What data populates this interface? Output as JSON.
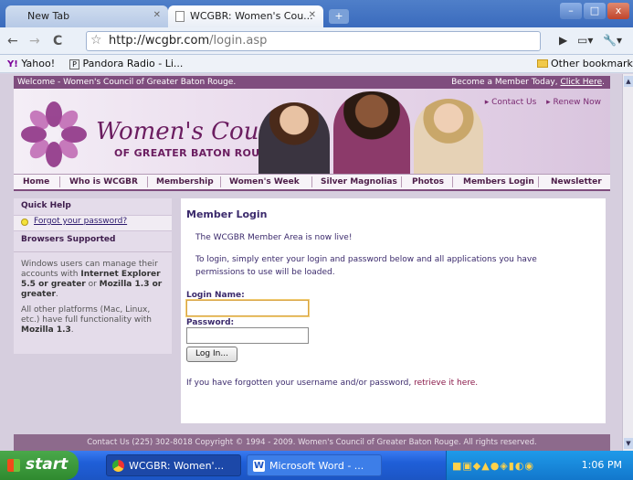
{
  "browser": {
    "tabs": [
      {
        "label": "New Tab"
      },
      {
        "label": "WCGBR: Women's Cou..."
      }
    ],
    "url_host": "http://wcgbr.com",
    "url_path": "/login.asp",
    "bookmarks": [
      "Yahoo!",
      "Pandora Radio - Li...",
      "Other bookmarks"
    ],
    "window_buttons": [
      "–",
      "□",
      "x"
    ]
  },
  "site": {
    "welcome": "Welcome - Women's Council of Greater Baton Rouge.",
    "become_member": "Become a Member Today,",
    "click_here": "Click Here",
    "toplinks": [
      "▸ Contact Us",
      "▸ Renew Now"
    ],
    "logo_script": "Women's Council",
    "logo_sub": "OF GREATER BATON ROUGE",
    "nav": [
      "Home",
      "Who is WCGBR",
      "Membership",
      "Women's Week",
      "Silver Magnolias",
      "Photos",
      "Members Login",
      "Newsletter"
    ]
  },
  "sidebar": {
    "quick_help": "Quick Help",
    "forgot_link": "Forgot your password?",
    "browsers_heading": "Browsers Supported",
    "text1_a": "Windows users can manage their accounts with ",
    "text1_b": "Internet Explorer 5.5 or greater",
    "text1_c": " or ",
    "text1_d": "Mozilla 1.3 or greater",
    "text1_e": ".",
    "text2_a": "All other platforms (Mac, Linux, etc.) have full functionality with ",
    "text2_b": "Mozilla 1.3",
    "text2_c": "."
  },
  "main": {
    "title": "Member Login",
    "p1": "The WCGBR Member Area is now live!",
    "p2": "To login, simply enter your login and password below and all applications you have permissions to use will be loaded.",
    "login_label": "Login Name:",
    "password_label": "Password:",
    "button": "Log In...",
    "forgot_prefix": "If you have forgotten your username and/or password,",
    "forgot_link": "retrieve it here."
  },
  "footer": "Contact Us (225) 302-8018 Copyright © 1994 - 2009. Women's Council of Greater Baton Rouge. All rights reserved.",
  "taskbar": {
    "start": "start",
    "tasks": [
      "WCGBR: Women'...",
      "Microsoft Word - ..."
    ],
    "clock": "1:06 PM"
  }
}
